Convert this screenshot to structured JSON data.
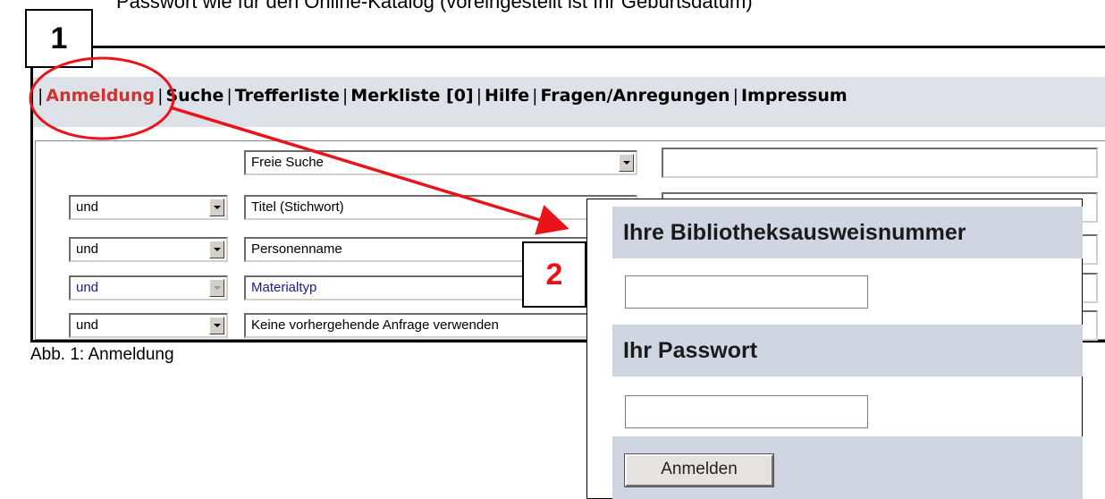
{
  "intro_text": "Passwort wie für den Online-Katalog (voreingestellt ist Ihr Geburtsdatum)",
  "nav": {
    "separator": "|",
    "items": [
      {
        "label": "Anmeldung",
        "active": true
      },
      {
        "label": "Suche",
        "active": false
      },
      {
        "label": "Trefferliste",
        "active": false
      },
      {
        "label": "Merkliste [0]",
        "active": false
      },
      {
        "label": "Hilfe",
        "active": false
      },
      {
        "label": "Fragen/Anregungen",
        "active": false
      },
      {
        "label": "Impressum",
        "active": false
      }
    ]
  },
  "search_rows": [
    {
      "operator": null,
      "field": "Freie Suche",
      "value": ""
    },
    {
      "operator": "und",
      "field": "Titel (Stichwort)",
      "value": ""
    },
    {
      "operator": "und",
      "field": "Personenname",
      "value": ""
    },
    {
      "operator": "und",
      "field": "Materialtyp",
      "value": "",
      "disabled": true
    },
    {
      "operator": "und",
      "field": "Keine vorhergehende Anfrage verwenden",
      "value": ""
    }
  ],
  "caption": "Abb. 1: Anmeldung",
  "badges": {
    "one": "1",
    "two": "2"
  },
  "login": {
    "card_number_label": "Ihre Bibliotheksausweisnummer",
    "card_number_value": "",
    "password_label": "Ihr Passwort",
    "password_value": "",
    "submit_label": "Anmelden"
  },
  "colors": {
    "active_nav": "#cc3333",
    "annotation": "#e8141a",
    "panel_header": "#cfd6e2",
    "nav_bar": "#dde1e8"
  }
}
